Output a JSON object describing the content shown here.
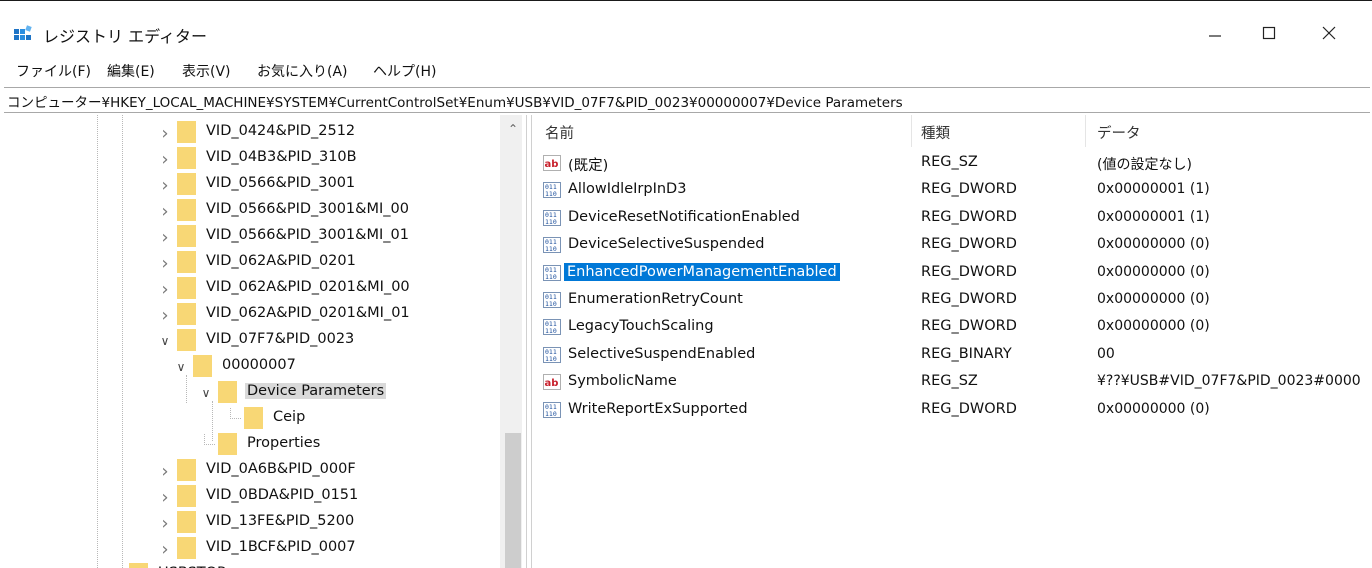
{
  "window": {
    "title": "レジストリ エディター",
    "controls": {
      "minimize": "minimize-icon",
      "maximize": "maximize-icon",
      "close": "close-icon"
    }
  },
  "menu": [
    {
      "label": "ファイル(F)"
    },
    {
      "label": "編集(E)"
    },
    {
      "label": "表示(V)"
    },
    {
      "label": "お気に入り(A)"
    },
    {
      "label": "ヘルプ(H)"
    }
  ],
  "address": "コンピューター¥HKEY_LOCAL_MACHINE¥SYSTEM¥CurrentControlSet¥Enum¥USB¥VID_07F7&PID_0023¥00000007¥Device Parameters",
  "tree": [
    {
      "label": "VID_0424&PID_2512",
      "expander": "collapsed",
      "level": 0
    },
    {
      "label": "VID_04B3&PID_310B",
      "expander": "collapsed",
      "level": 0
    },
    {
      "label": "VID_0566&PID_3001",
      "expander": "collapsed",
      "level": 0
    },
    {
      "label": "VID_0566&PID_3001&MI_00",
      "expander": "collapsed",
      "level": 0
    },
    {
      "label": "VID_0566&PID_3001&MI_01",
      "expander": "collapsed",
      "level": 0
    },
    {
      "label": "VID_062A&PID_0201",
      "expander": "collapsed",
      "level": 0
    },
    {
      "label": "VID_062A&PID_0201&MI_00",
      "expander": "collapsed",
      "level": 0
    },
    {
      "label": "VID_062A&PID_0201&MI_01",
      "expander": "collapsed",
      "level": 0
    },
    {
      "label": "VID_07F7&PID_0023",
      "expander": "expanded",
      "level": 0
    },
    {
      "label": "00000007",
      "expander": "expanded",
      "level": 1
    },
    {
      "label": "Device Parameters",
      "expander": "expanded",
      "level": 2,
      "selected": true
    },
    {
      "label": "Ceip",
      "expander": "none",
      "level": 3
    },
    {
      "label": "Properties",
      "expander": "none",
      "level": 2
    },
    {
      "label": "VID_0A6B&PID_000F",
      "expander": "collapsed",
      "level": 0
    },
    {
      "label": "VID_0BDA&PID_0151",
      "expander": "collapsed",
      "level": 0
    },
    {
      "label": "VID_13FE&PID_5200",
      "expander": "collapsed",
      "level": 0
    },
    {
      "label": "VID_1BCF&PID_0007",
      "expander": "collapsed",
      "level": 0
    },
    {
      "label": "USBSTOR",
      "expander": "collapsed",
      "level": -1
    }
  ],
  "list": {
    "headers": {
      "name": "名前",
      "type": "種類",
      "data": "データ"
    },
    "rows": [
      {
        "icon": "string",
        "name": "(既定)",
        "type": "REG_SZ",
        "data": "(値の設定なし)"
      },
      {
        "icon": "binary",
        "name": "AllowIdleIrpInD3",
        "type": "REG_DWORD",
        "data": "0x00000001 (1)"
      },
      {
        "icon": "binary",
        "name": "DeviceResetNotificationEnabled",
        "type": "REG_DWORD",
        "data": "0x00000001 (1)"
      },
      {
        "icon": "binary",
        "name": "DeviceSelectiveSuspended",
        "type": "REG_DWORD",
        "data": "0x00000000 (0)"
      },
      {
        "icon": "binary",
        "name": "EnhancedPowerManagementEnabled",
        "type": "REG_DWORD",
        "data": "0x00000000 (0)",
        "selected": true
      },
      {
        "icon": "binary",
        "name": "EnumerationRetryCount",
        "type": "REG_DWORD",
        "data": "0x00000000 (0)"
      },
      {
        "icon": "binary",
        "name": "LegacyTouchScaling",
        "type": "REG_DWORD",
        "data": "0x00000000 (0)"
      },
      {
        "icon": "binary",
        "name": "SelectiveSuspendEnabled",
        "type": "REG_BINARY",
        "data": "00"
      },
      {
        "icon": "string",
        "name": "SymbolicName",
        "type": "REG_SZ",
        "data": "¥??¥USB#VID_07F7&PID_0023#0000"
      },
      {
        "icon": "binary",
        "name": "WriteReportExSupported",
        "type": "REG_DWORD",
        "data": "0x00000000 (0)"
      }
    ]
  },
  "colors": {
    "selection": "#0078d7",
    "tree_selection": "#d9d9d9",
    "folder": "#f8d775"
  }
}
